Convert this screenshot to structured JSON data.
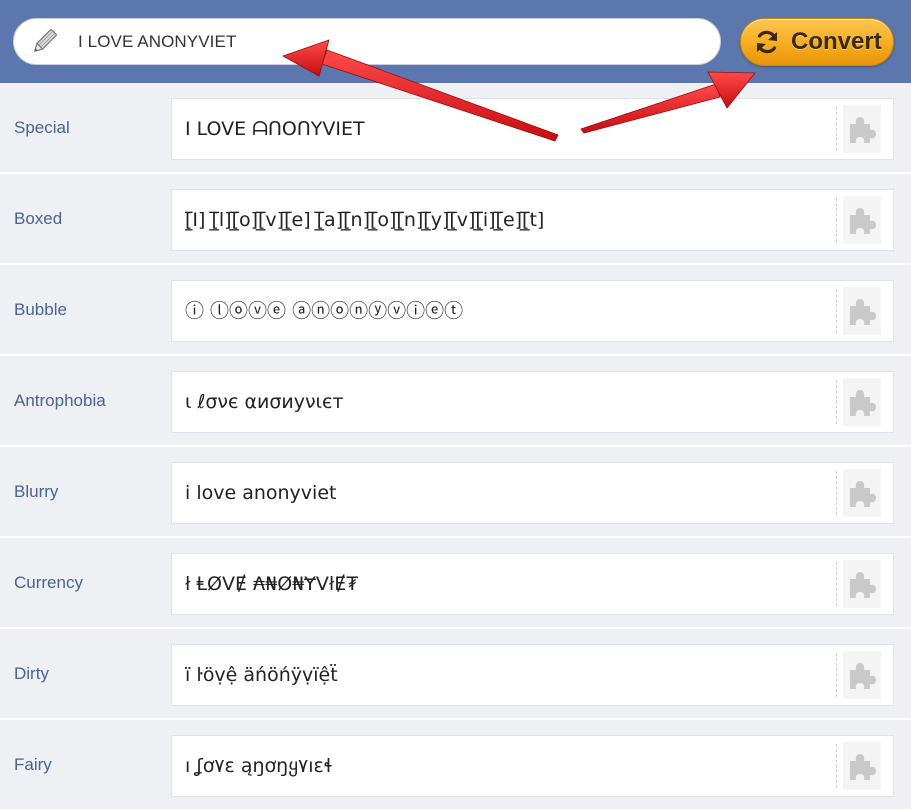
{
  "search": {
    "value": "I LOVE ANONYVIET",
    "icon": "pencil-icon"
  },
  "convert_button": {
    "label": "Convert",
    "icon": "refresh-icon"
  },
  "colors": {
    "header": "#5b77ad",
    "button": "#f6ad1a",
    "label": "#4a6294",
    "row_background": "#eef0f4",
    "annotation_arrow": "#e8141a"
  },
  "rows": [
    {
      "label": "Special",
      "output": "I LOVE ᗩᑎOᑎYVIET"
    },
    {
      "label": "Boxed",
      "output": "[̲̅I] [̲̅l][̲̅o][̲̅v][̲̅e] [̲̅a][̲̅n][̲̅o][̲̅n][̲̅y][̲̅v][̲̅i][̲̅e][̲̅t]"
    },
    {
      "label": "Bubble",
      "output": "ⓘ ⓛⓞⓥⓔ ⓐⓝⓞⓝⓨⓥⓘⓔⓣ"
    },
    {
      "label": "Antrophobia",
      "output": "ι ℓσνє αиσиуνιєт"
    },
    {
      "label": "Blurry",
      "output": "i love anonyviet"
    },
    {
      "label": "Currency",
      "output": "ł ⱠØVɆ ₳₦Ø₦ɎVłɆ₮"
    },
    {
      "label": "Dirty",
      "output": "ï ŀöṿệ äńöńÿṿïệẗ"
    },
    {
      "label": "Fairy",
      "output": "ı ʆơ۷ɛ ąŋơŋყ۷ıɛɬ"
    }
  ],
  "row_action_icon": "puzzle-icon"
}
